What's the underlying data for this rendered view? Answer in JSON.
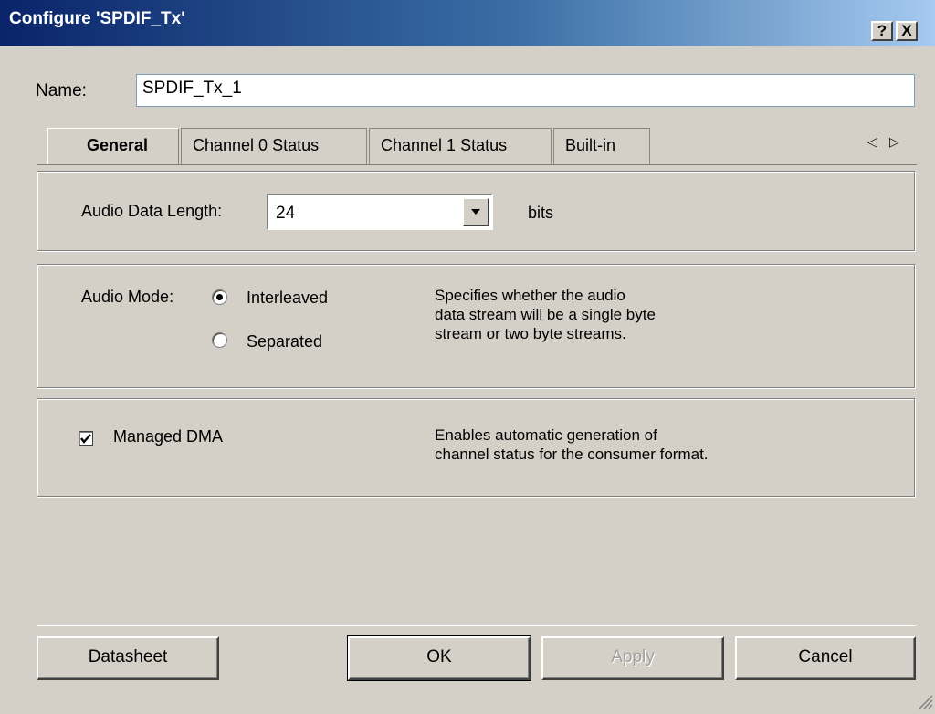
{
  "window": {
    "title": "Configure 'SPDIF_Tx'",
    "help_btn": "?",
    "close_btn": "X"
  },
  "name_row": {
    "label": "Name:",
    "value": "SPDIF_Tx_1"
  },
  "tabs": [
    {
      "label": "General",
      "active": true
    },
    {
      "label": "Channel 0 Status",
      "active": false
    },
    {
      "label": "Channel 1 Status",
      "active": false
    },
    {
      "label": "Built-in",
      "active": false
    }
  ],
  "tab_scroll": {
    "left": "◁",
    "right": "▷"
  },
  "audio_data_length": {
    "label": "Audio Data Length:",
    "value": "24",
    "unit": "bits"
  },
  "audio_mode": {
    "label": "Audio Mode:",
    "options": [
      {
        "label": "Interleaved",
        "selected": true
      },
      {
        "label": "Separated",
        "selected": false
      }
    ],
    "description": "Specifies whether the audio\ndata stream will be a single byte\nstream or two byte streams."
  },
  "managed_dma": {
    "label": "Managed DMA",
    "checked": true,
    "description": "Enables automatic generation of\nchannel status for the consumer format."
  },
  "buttons": {
    "datasheet": "Datasheet",
    "ok": "OK",
    "apply": "Apply",
    "cancel": "Cancel"
  },
  "colors": {
    "title_start": "#0a246a",
    "title_end": "#a6caf0",
    "face": "#d4d0c8"
  }
}
